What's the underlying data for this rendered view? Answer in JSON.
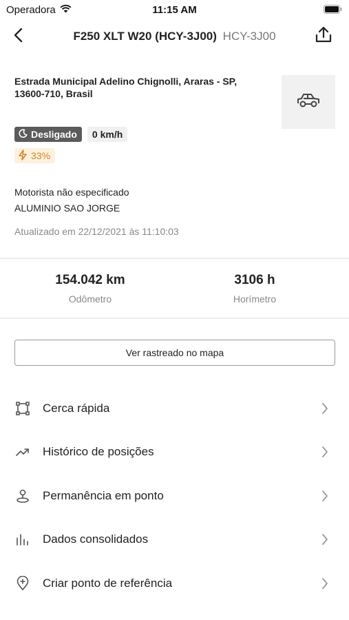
{
  "status_bar": {
    "carrier": "Operadora",
    "time": "11:15 AM"
  },
  "nav": {
    "title": "F250 XLT W20 (HCY-3J00)",
    "plate": "HCY-3J00",
    "back_icon": "chevron-left-icon",
    "share_icon": "share-icon"
  },
  "vehicle": {
    "address": "Estrada Municipal Adelino Chignolli, Araras - SP, 13600-710, Brasil",
    "icon": "car-icon",
    "status_label": "Desligado",
    "speed": "0 km/h",
    "battery": "33%",
    "driver": "Motorista não especificado",
    "company": "ALUMINIO SAO JORGE",
    "updated": "Atualizado em 22/12/2021 às 11:10:03"
  },
  "stats": {
    "odometer_value": "154.042 km",
    "odometer_label": "Odômetro",
    "hourmeter_value": "3106 h",
    "hourmeter_label": "Horímetro"
  },
  "map_button_label": "Ver rastreado no mapa",
  "menu": [
    {
      "label": "Cerca rápida",
      "icon": "fence-icon"
    },
    {
      "label": "Histórico de posições",
      "icon": "trend-icon"
    },
    {
      "label": "Permanência em ponto",
      "icon": "pin-person-icon"
    },
    {
      "label": "Dados consolidados",
      "icon": "bar-chart-icon"
    },
    {
      "label": "Criar ponto de referência",
      "icon": "add-location-icon"
    }
  ],
  "colors": {
    "status_badge_bg": "#5b5b5b",
    "battery_badge_bg": "#fdf1de",
    "battery_text": "#d0852a"
  }
}
